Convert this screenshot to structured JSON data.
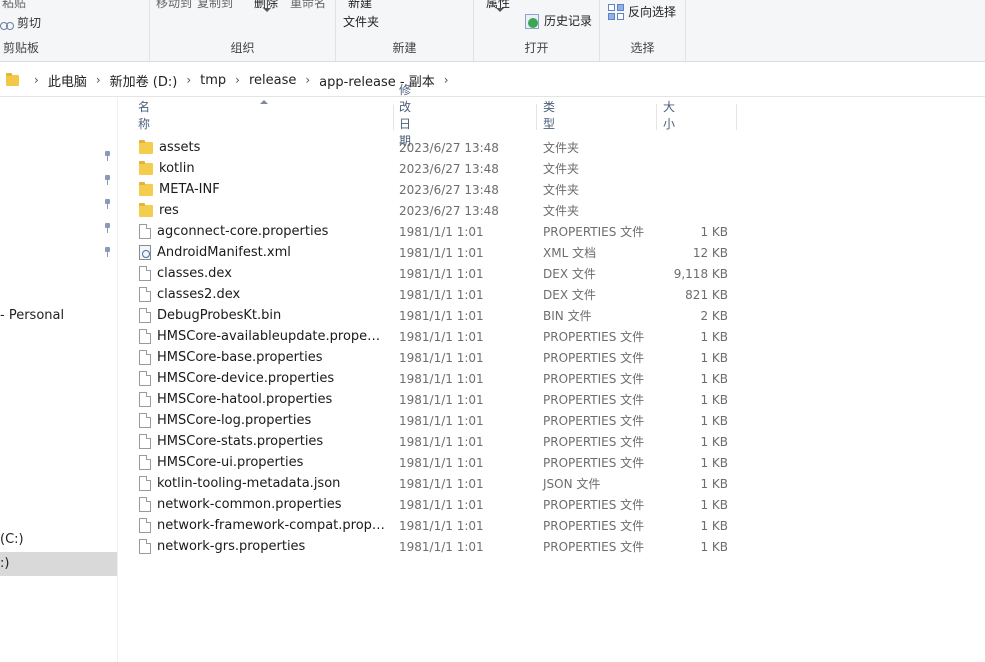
{
  "ribbon": {
    "clipboard": {
      "paste_label": "粘贴",
      "cut_label": "剪切",
      "group_label": "剪贴板"
    },
    "organize": {
      "move_label": "移动到",
      "copy_label": "复制到",
      "delete_label": "删除",
      "rename_label": "重命名",
      "group_label": "组织"
    },
    "new": {
      "new_label": "新建",
      "folder_label": "文件夹",
      "group_label": "新建"
    },
    "open": {
      "properties_label": "属性",
      "history_label": "历史记录",
      "group_label": "打开"
    },
    "select": {
      "invert_label": "反向选择",
      "group_label": "选择"
    }
  },
  "address": {
    "crumbs": [
      "此电脑",
      "新加卷 (D:)",
      "tmp",
      "release",
      "app-release - 副本"
    ]
  },
  "nav": {
    "personal_label": "- Personal",
    "drive_c_label": "(C:)",
    "drive_d_label": ":)"
  },
  "columns": {
    "name": "名称",
    "date": "修改日期",
    "type": "类型",
    "size": "大小"
  },
  "files": [
    {
      "name": "assets",
      "date": "2023/6/27 13:48",
      "type": "文件夹",
      "size": "",
      "icon": "folder-icon"
    },
    {
      "name": "kotlin",
      "date": "2023/6/27 13:48",
      "type": "文件夹",
      "size": "",
      "icon": "folder-icon"
    },
    {
      "name": "META-INF",
      "date": "2023/6/27 13:48",
      "type": "文件夹",
      "size": "",
      "icon": "folder-icon"
    },
    {
      "name": "res",
      "date": "2023/6/27 13:48",
      "type": "文件夹",
      "size": "",
      "icon": "folder-icon"
    },
    {
      "name": "agconnect-core.properties",
      "date": "1981/1/1 1:01",
      "type": "PROPERTIES 文件",
      "size": "1 KB",
      "icon": "file-icon"
    },
    {
      "name": "AndroidManifest.xml",
      "date": "1981/1/1 1:01",
      "type": "XML 文档",
      "size": "12 KB",
      "icon": "xml-file-icon"
    },
    {
      "name": "classes.dex",
      "date": "1981/1/1 1:01",
      "type": "DEX 文件",
      "size": "9,118 KB",
      "icon": "file-icon"
    },
    {
      "name": "classes2.dex",
      "date": "1981/1/1 1:01",
      "type": "DEX 文件",
      "size": "821 KB",
      "icon": "file-icon"
    },
    {
      "name": "DebugProbesKt.bin",
      "date": "1981/1/1 1:01",
      "type": "BIN 文件",
      "size": "2 KB",
      "icon": "file-icon"
    },
    {
      "name": "HMSCore-availableupdate.properties",
      "date": "1981/1/1 1:01",
      "type": "PROPERTIES 文件",
      "size": "1 KB",
      "icon": "file-icon"
    },
    {
      "name": "HMSCore-base.properties",
      "date": "1981/1/1 1:01",
      "type": "PROPERTIES 文件",
      "size": "1 KB",
      "icon": "file-icon"
    },
    {
      "name": "HMSCore-device.properties",
      "date": "1981/1/1 1:01",
      "type": "PROPERTIES 文件",
      "size": "1 KB",
      "icon": "file-icon"
    },
    {
      "name": "HMSCore-hatool.properties",
      "date": "1981/1/1 1:01",
      "type": "PROPERTIES 文件",
      "size": "1 KB",
      "icon": "file-icon"
    },
    {
      "name": "HMSCore-log.properties",
      "date": "1981/1/1 1:01",
      "type": "PROPERTIES 文件",
      "size": "1 KB",
      "icon": "file-icon"
    },
    {
      "name": "HMSCore-stats.properties",
      "date": "1981/1/1 1:01",
      "type": "PROPERTIES 文件",
      "size": "1 KB",
      "icon": "file-icon"
    },
    {
      "name": "HMSCore-ui.properties",
      "date": "1981/1/1 1:01",
      "type": "PROPERTIES 文件",
      "size": "1 KB",
      "icon": "file-icon"
    },
    {
      "name": "kotlin-tooling-metadata.json",
      "date": "1981/1/1 1:01",
      "type": "JSON 文件",
      "size": "1 KB",
      "icon": "file-icon"
    },
    {
      "name": "network-common.properties",
      "date": "1981/1/1 1:01",
      "type": "PROPERTIES 文件",
      "size": "1 KB",
      "icon": "file-icon"
    },
    {
      "name": "network-framework-compat.properti...",
      "date": "1981/1/1 1:01",
      "type": "PROPERTIES 文件",
      "size": "1 KB",
      "icon": "file-icon"
    },
    {
      "name": "network-grs.properties",
      "date": "1981/1/1 1:01",
      "type": "PROPERTIES 文件",
      "size": "1 KB",
      "icon": "file-icon"
    }
  ]
}
